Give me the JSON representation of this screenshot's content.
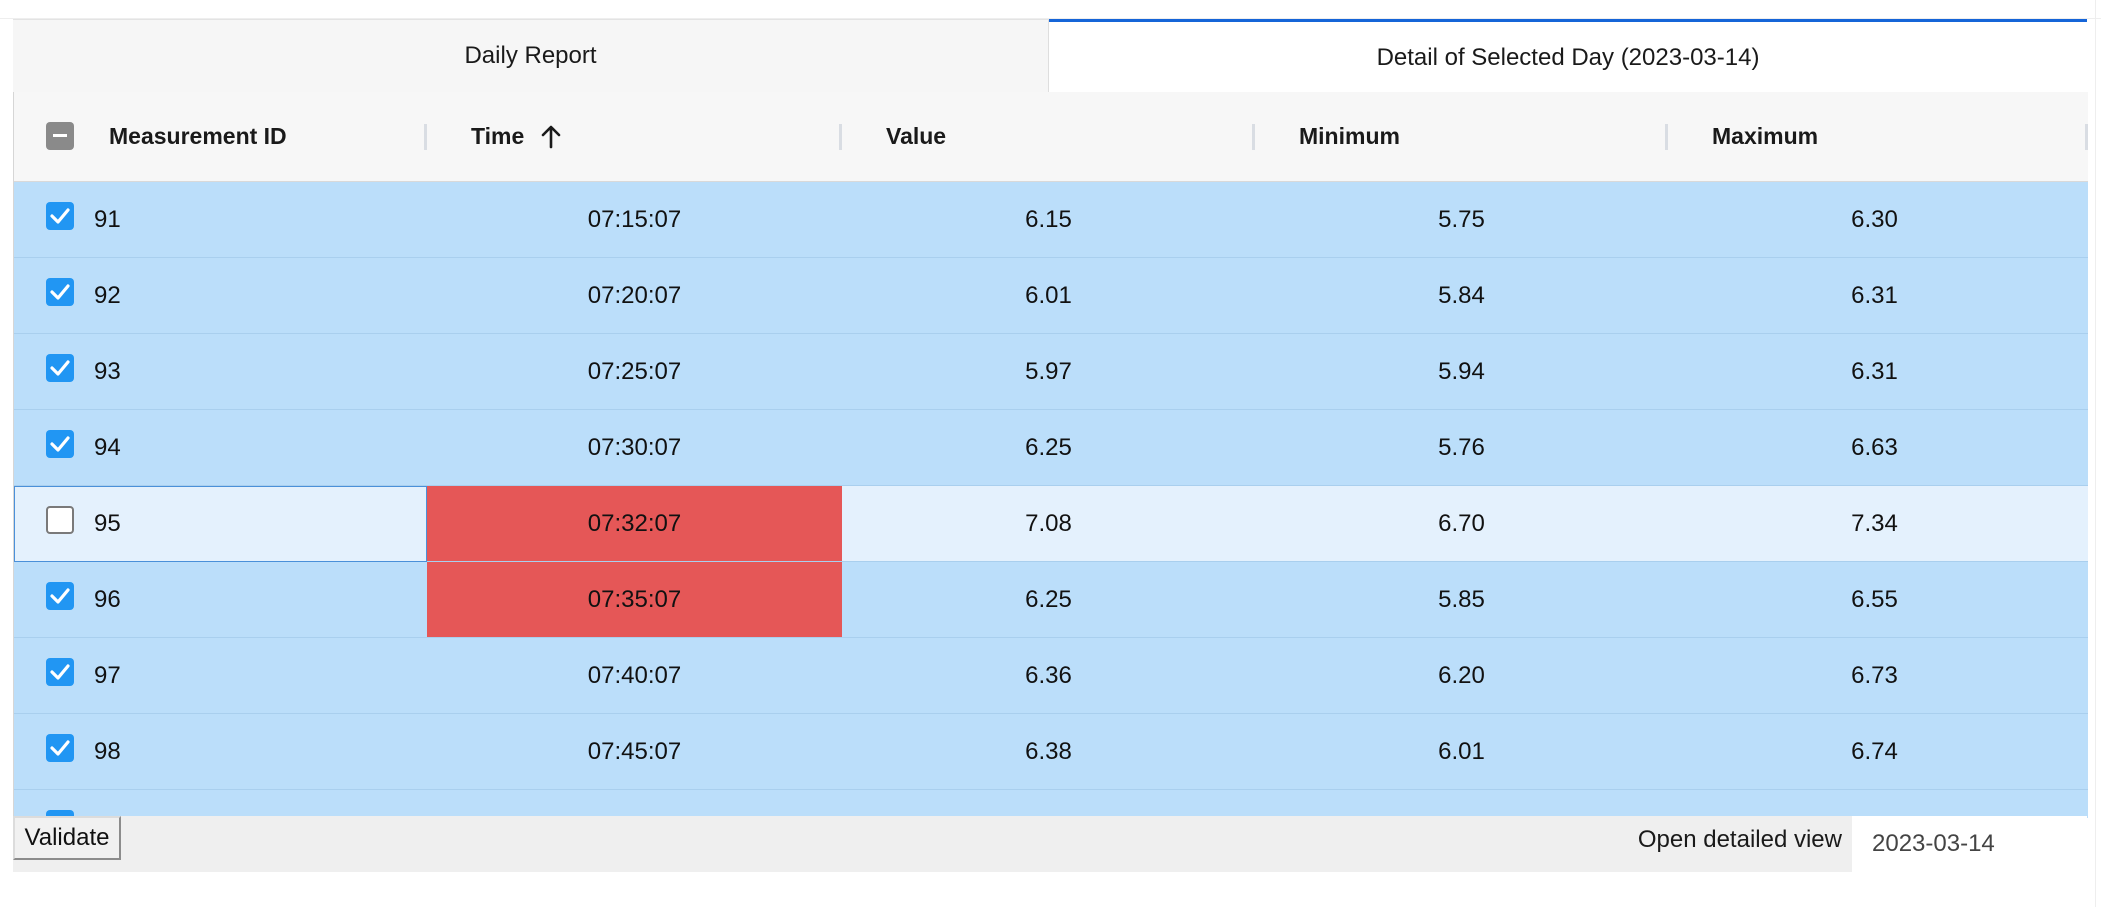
{
  "tabs": {
    "daily_report": "Daily Report",
    "detail_selected_day": "Detail of Selected Day (2023-03-14)"
  },
  "grid": {
    "columns": {
      "measurement_id": "Measurement ID",
      "time": "Time",
      "value": "Value",
      "minimum": "Minimum",
      "maximum": "Maximum"
    },
    "sort": {
      "column": "Time",
      "direction": "ascending",
      "icon": "arrow-up-icon"
    },
    "select_all_state": "indeterminate",
    "rows": [
      {
        "id": "91",
        "time": "07:15:07",
        "value": "6.15",
        "minimum": "5.75",
        "maximum": "6.30",
        "checked": true,
        "time_flagged": false
      },
      {
        "id": "92",
        "time": "07:20:07",
        "value": "6.01",
        "minimum": "5.84",
        "maximum": "6.31",
        "checked": true,
        "time_flagged": false
      },
      {
        "id": "93",
        "time": "07:25:07",
        "value": "5.97",
        "minimum": "5.94",
        "maximum": "6.31",
        "checked": true,
        "time_flagged": false
      },
      {
        "id": "94",
        "time": "07:30:07",
        "value": "6.25",
        "minimum": "5.76",
        "maximum": "6.63",
        "checked": true,
        "time_flagged": false
      },
      {
        "id": "95",
        "time": "07:32:07",
        "value": "7.08",
        "minimum": "6.70",
        "maximum": "7.34",
        "checked": false,
        "time_flagged": true
      },
      {
        "id": "96",
        "time": "07:35:07",
        "value": "6.25",
        "minimum": "5.85",
        "maximum": "6.55",
        "checked": true,
        "time_flagged": true
      },
      {
        "id": "97",
        "time": "07:40:07",
        "value": "6.36",
        "minimum": "6.20",
        "maximum": "6.73",
        "checked": true,
        "time_flagged": false
      },
      {
        "id": "98",
        "time": "07:45:07",
        "value": "6.38",
        "minimum": "6.01",
        "maximum": "6.74",
        "checked": true,
        "time_flagged": false
      },
      {
        "id": "",
        "time": "",
        "value": "",
        "minimum": "",
        "maximum": "",
        "checked": true,
        "time_flagged": false
      }
    ]
  },
  "footer": {
    "validate_label": "Validate",
    "open_detailed_view_label": "Open detailed view",
    "date_value": "2023-03-14"
  },
  "colors": {
    "selected_row": "#bbdefa",
    "unselected_row": "#e4f1fd",
    "flagged_cell": "#e55757",
    "checkbox_checked": "#2196f3",
    "active_tab_accent": "#1565d8"
  }
}
